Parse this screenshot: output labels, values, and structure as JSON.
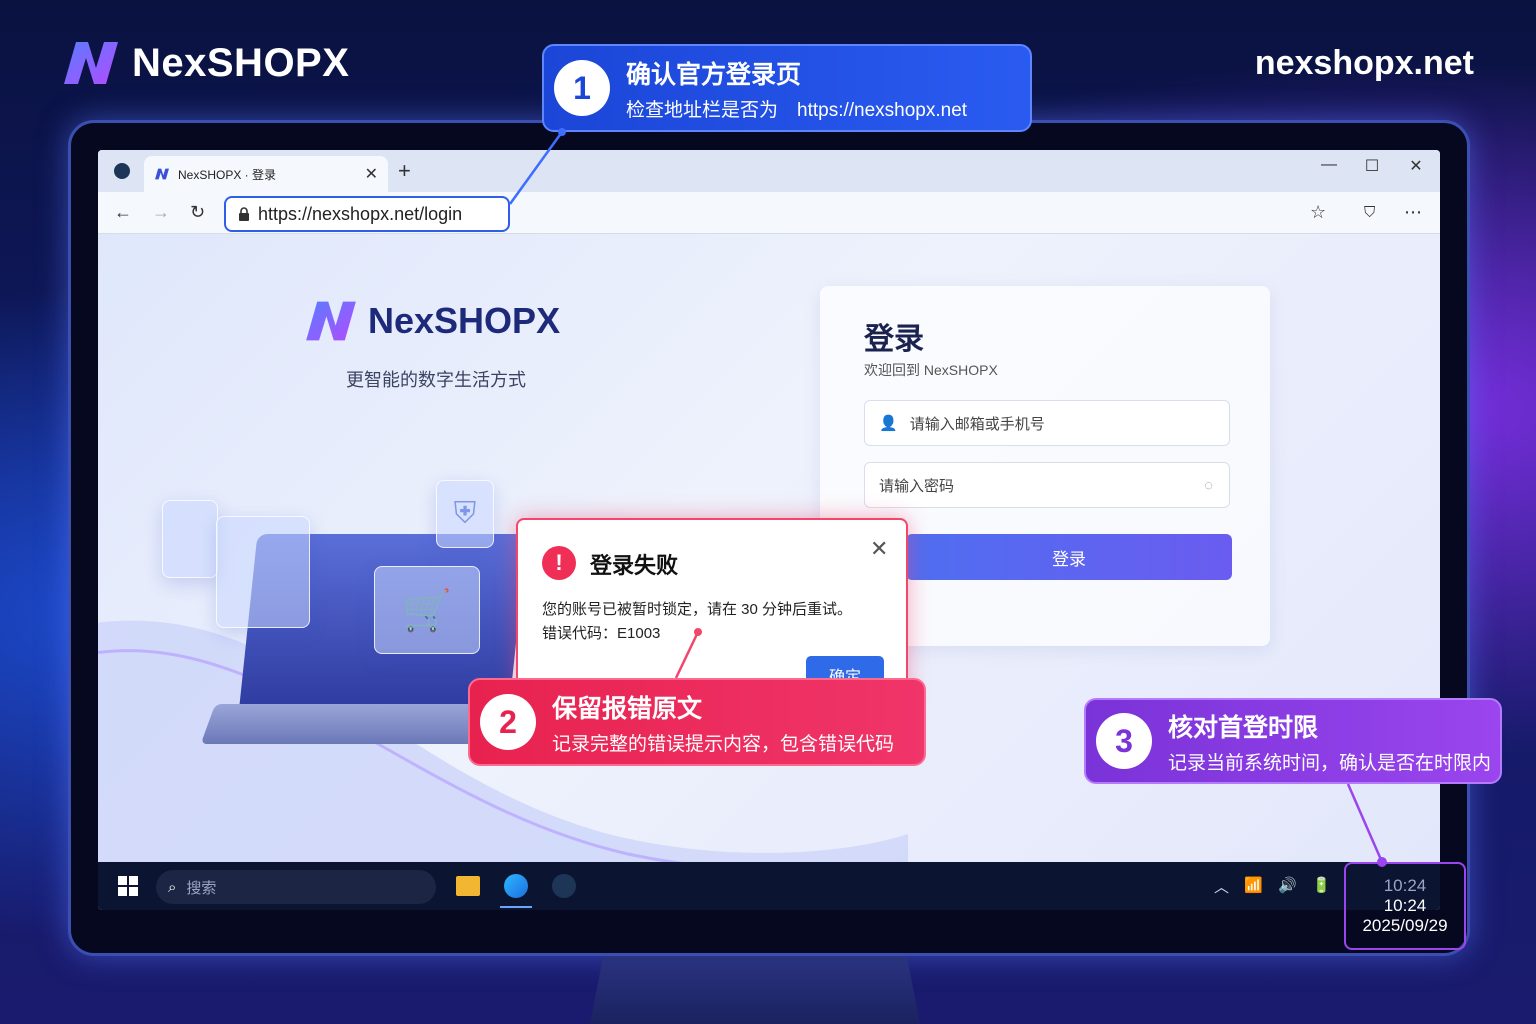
{
  "brand": {
    "name": "NexSHOPX",
    "site": "nexshopx.net"
  },
  "browser": {
    "tab_title": "NexSHOPX · 登录",
    "new_tab": "+",
    "url": "https://nexshopx.net/login",
    "window_controls": [
      "—",
      "☐",
      "✕"
    ]
  },
  "page": {
    "logo_text": "NexSHOPX",
    "tagline": "更智能的数字生活方式",
    "login": {
      "title": "登录",
      "subtitle": "欢迎回到 NexSHOPX",
      "account_placeholder": "请输入邮箱或手机号",
      "password_placeholder": "请输入密码",
      "button": "登录"
    }
  },
  "dialog": {
    "title": "登录失败",
    "message": "您的账号已被暂时锁定，请在 30 分钟后重试。",
    "error_code": "错误代码：E1003",
    "ok": "确定"
  },
  "taskbar": {
    "search_placeholder": "搜索",
    "clock_faded": "10:24",
    "time": "10:24",
    "date": "2025/09/29"
  },
  "callouts": [
    {
      "num": "1",
      "title": "确认官方登录页",
      "desc": "检查地址栏是否为　https://nexshopx.net"
    },
    {
      "num": "2",
      "title": "保留报错原文",
      "desc": "记录完整的错误提示内容，包含错误代码"
    },
    {
      "num": "3",
      "title": "核对首登时限",
      "desc": "记录当前系统时间，确认是否在时限内"
    }
  ],
  "colors": {
    "callout1": "#1b46d8",
    "callout2": "#e8224f",
    "callout3": "#7a33d8",
    "primary": "#2f6be8"
  }
}
